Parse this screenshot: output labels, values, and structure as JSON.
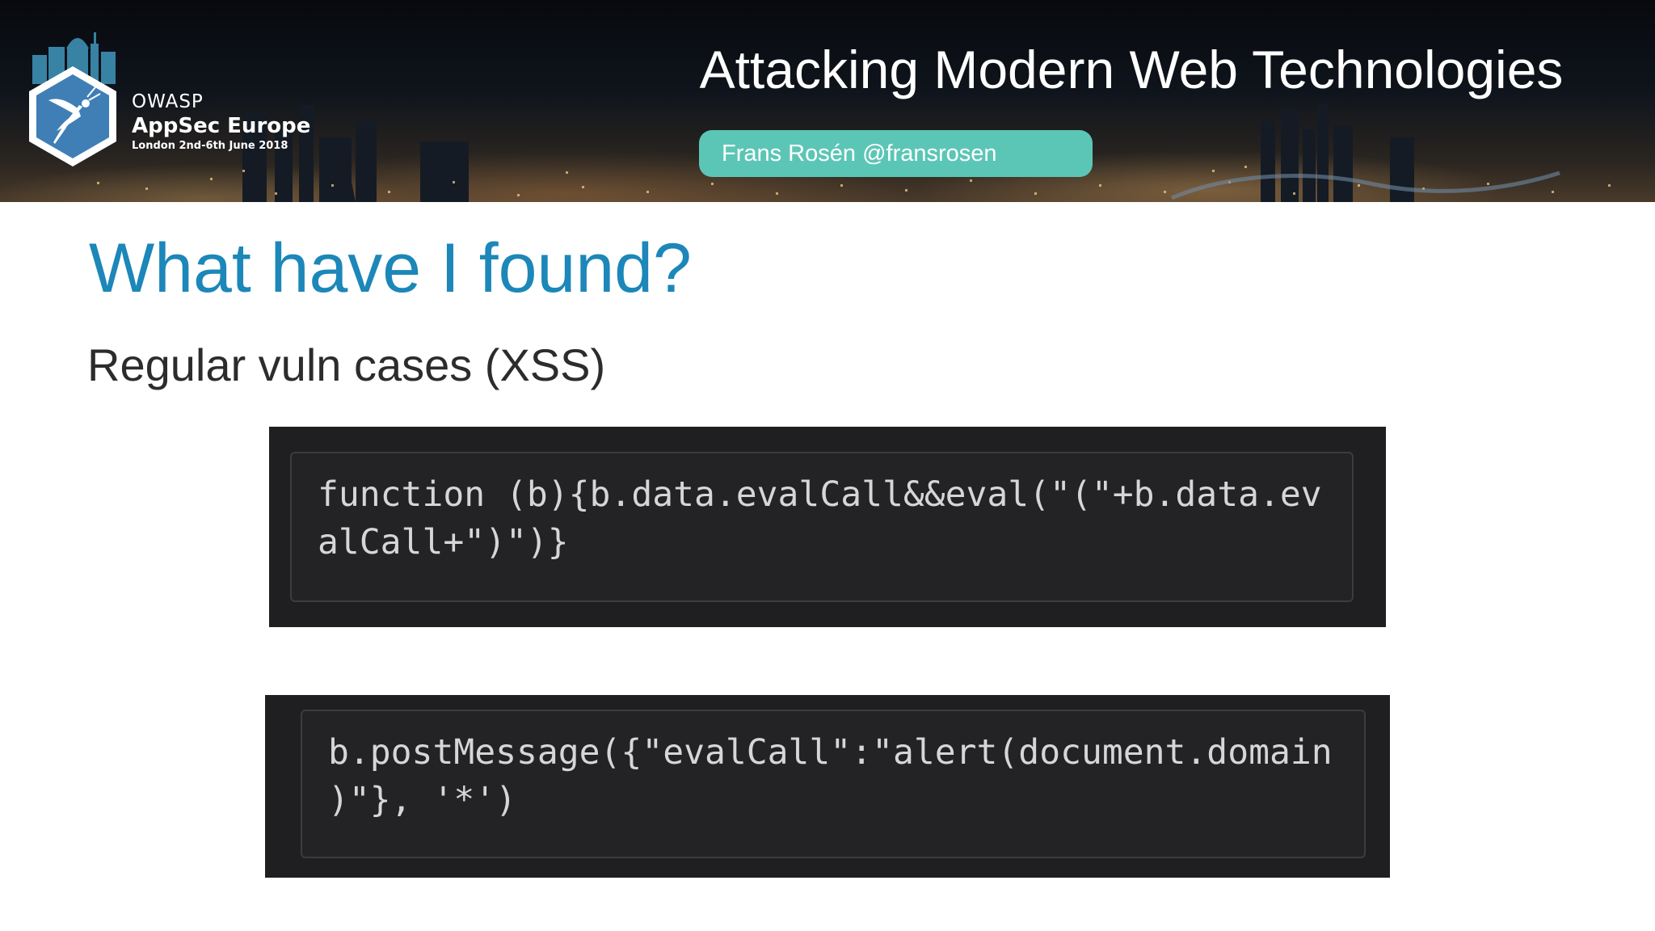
{
  "banner": {
    "brand": {
      "org": "OWASP",
      "event": "AppSec Europe",
      "dates": "London 2nd-6th June 2018"
    },
    "title": "Attacking Modern Web Technologies",
    "speaker": "Frans Rosén @fransrosen"
  },
  "slide": {
    "heading": "What have I found?",
    "subheading": "Regular vuln cases (XSS)",
    "code_blocks": [
      {
        "lines": [
          "function (b){b.data.evalCall&&eval(\"(\"+b.data.ev",
          "alCall+\")\")}"
        ]
      },
      {
        "lines": [
          "b.postMessage({\"evalCall\":\"alert(document.domain",
          ")\"}, '*')"
        ]
      }
    ]
  },
  "colors": {
    "heading": "#1c87b8",
    "speaker_pill": "#5cc6b6",
    "code_background": "#232325",
    "code_text": "#d6d6d6"
  },
  "icons": [
    "owasp-wasp-logo-icon",
    "london-skyline-icon"
  ]
}
